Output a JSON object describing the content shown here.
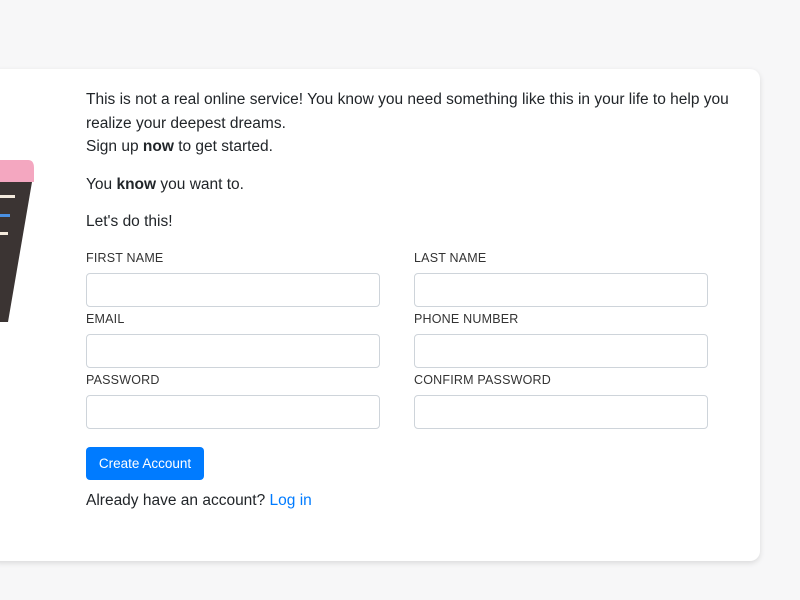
{
  "intro": {
    "line1": "This is not a real online service! You know you need something like this in your life to help you realize your deepest dreams.",
    "line2_pre": "Sign up ",
    "line2_bold": "now",
    "line2_post": " to get started."
  },
  "para1": {
    "pre": "You ",
    "bold": "know",
    "post": " you want to."
  },
  "para2": "Let's do this!",
  "form": {
    "first_name_label": "FIRST NAME",
    "last_name_label": "LAST NAME",
    "email_label": "EMAIL",
    "phone_label": "PHONE NUMBER",
    "password_label": "PASSWORD",
    "confirm_password_label": "CONFIRM PASSWORD"
  },
  "actions": {
    "create_account_label": "Create Account",
    "login_prompt": "Already have an account? ",
    "login_link": "Log in"
  },
  "colors": {
    "primary": "#007bff",
    "illustration_pink": "#f4a7c0",
    "illustration_dark": "#3b3433",
    "illustration_blue": "#4a90e2"
  }
}
